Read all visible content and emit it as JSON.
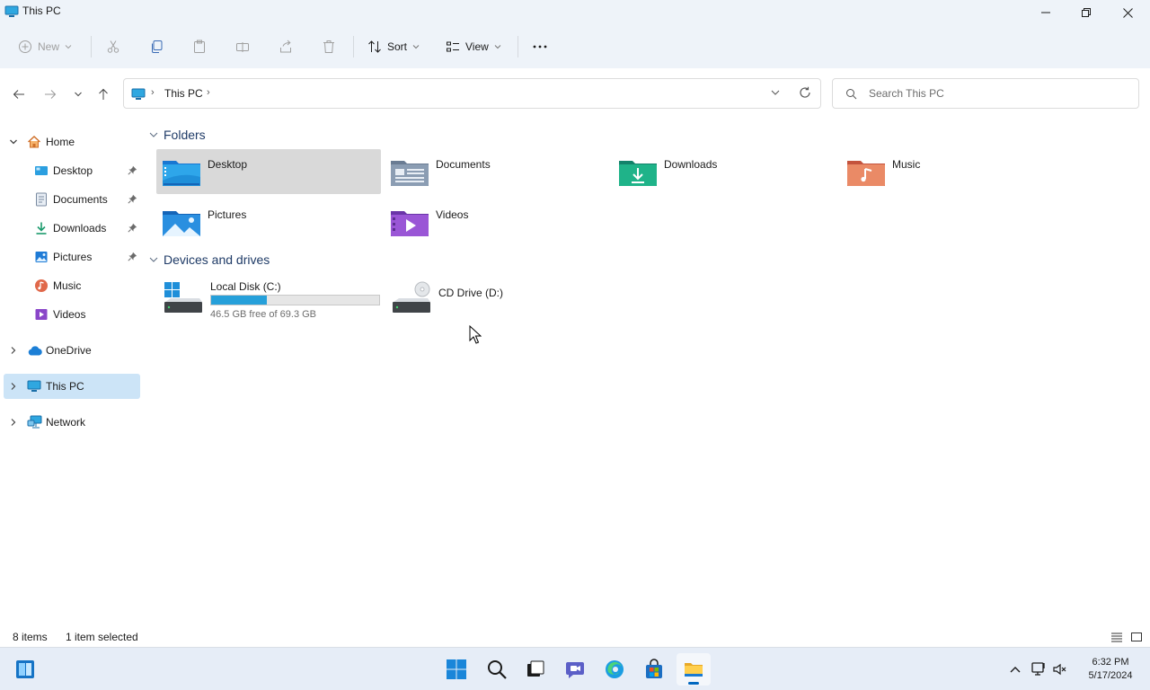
{
  "window": {
    "title": "This PC"
  },
  "commands": {
    "new": "New",
    "sort": "Sort",
    "view": "View"
  },
  "address": {
    "crumb": "This PC",
    "search_placeholder": "Search This PC"
  },
  "sidebar": {
    "home": "Home",
    "quick": [
      {
        "label": "Desktop",
        "pinned": true
      },
      {
        "label": "Documents",
        "pinned": true
      },
      {
        "label": "Downloads",
        "pinned": true
      },
      {
        "label": "Pictures",
        "pinned": true
      },
      {
        "label": "Music",
        "pinned": false
      },
      {
        "label": "Videos",
        "pinned": false
      }
    ],
    "onedrive": "OneDrive",
    "thispc": "This PC",
    "network": "Network"
  },
  "content": {
    "folders_header": "Folders",
    "folders": [
      {
        "label": "Desktop",
        "icon": "desktop-folder-icon",
        "selected": true
      },
      {
        "label": "Documents",
        "icon": "documents-folder-icon"
      },
      {
        "label": "Downloads",
        "icon": "downloads-folder-icon"
      },
      {
        "label": "Music",
        "icon": "music-folder-icon"
      },
      {
        "label": "Pictures",
        "icon": "pictures-folder-icon"
      },
      {
        "label": "Videos",
        "icon": "videos-folder-icon"
      }
    ],
    "drives_header": "Devices and drives",
    "drives": [
      {
        "label": "Local Disk (C:)",
        "free_text": "46.5 GB free of 69.3 GB",
        "used_fraction": 0.329
      },
      {
        "label": "CD Drive (D:)"
      }
    ]
  },
  "status": {
    "items": "8 items",
    "selected": "1 item selected"
  },
  "clock": {
    "time": "6:32 PM",
    "date": "5/17/2024"
  },
  "colors": {
    "accent": "#0067c0",
    "selection": "#cce4f7",
    "drive_bar": "#26a0da"
  }
}
